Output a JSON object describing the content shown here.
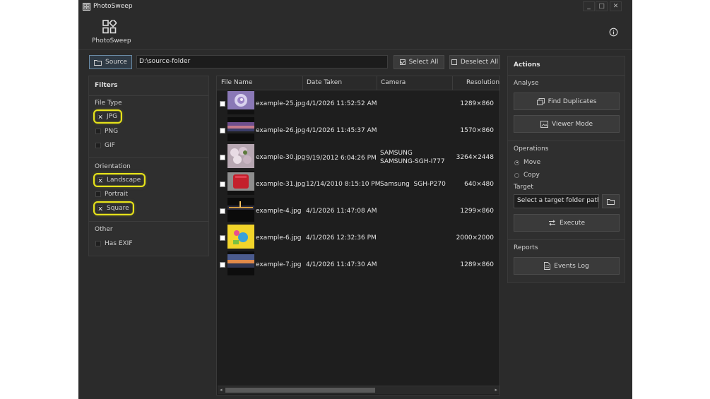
{
  "window": {
    "title": "PhotoSweep",
    "controls": {
      "minimize": "_",
      "maximize": "□",
      "close": "✕"
    }
  },
  "brand": {
    "label": "PhotoSweep",
    "icon": "apps-grid-icon"
  },
  "toolbar": {
    "source_label": "Source",
    "source_path": "D:\\source-folder",
    "select_all_label": "Select All",
    "deselect_all_label": "Deselect All"
  },
  "filters": {
    "title": "Filters",
    "groups": [
      {
        "label": "File Type",
        "items": [
          {
            "label": "JPG",
            "checked": true,
            "highlighted": true
          },
          {
            "label": "PNG",
            "checked": false,
            "highlighted": false
          },
          {
            "label": "GIF",
            "checked": false,
            "highlighted": false
          }
        ]
      },
      {
        "label": "Orientation",
        "items": [
          {
            "label": "Landscape",
            "checked": true,
            "highlighted": true
          },
          {
            "label": "Portrait",
            "checked": false,
            "highlighted": false
          },
          {
            "label": "Square",
            "checked": true,
            "highlighted": true
          }
        ]
      },
      {
        "label": "Other",
        "items": [
          {
            "label": "Has EXIF",
            "checked": false,
            "highlighted": false
          }
        ]
      }
    ],
    "highlight_color": "#e6e21a"
  },
  "table": {
    "columns": [
      "File Name",
      "Date Taken",
      "Camera",
      "Resolution"
    ],
    "rows": [
      {
        "file": "example-25.jpg",
        "date": "4/1/2026 11:52:52 AM",
        "camera": "",
        "res": "1289×860"
      },
      {
        "file": "example-26.jpg",
        "date": "4/1/2026 11:45:37 AM",
        "camera": "",
        "res": "1570×860"
      },
      {
        "file": "example-30.jpg",
        "date": "9/19/2012 6:04:26 PM",
        "camera": "SAMSUNG\nSAMSUNG-SGH-I777",
        "res": "3264×2448"
      },
      {
        "file": "example-31.jpg",
        "date": "12/14/2010 8:15:10 PM",
        "camera": "Samsung  SGH-P270",
        "res": "640×480"
      },
      {
        "file": "example-4.jpg",
        "date": "4/1/2026 11:47:08 AM",
        "camera": "",
        "res": "1299×860"
      },
      {
        "file": "example-6.jpg",
        "date": "4/1/2026 12:32:36 PM",
        "camera": "",
        "res": "2000×2000"
      },
      {
        "file": "example-7.jpg",
        "date": "4/1/2026 11:47:30 AM",
        "camera": "",
        "res": "1289×860"
      }
    ]
  },
  "actions": {
    "title": "Actions",
    "analyse_label": "Analyse",
    "find_duplicates_label": "Find Duplicates",
    "viewer_mode_label": "Viewer Mode",
    "operations_label": "Operations",
    "move_label": "Move",
    "copy_label": "Copy",
    "selected_operation": "Move",
    "target_label": "Target",
    "target_placeholder": "Select a target folder path...",
    "execute_label": "Execute",
    "reports_label": "Reports",
    "events_log_label": "Events Log"
  }
}
